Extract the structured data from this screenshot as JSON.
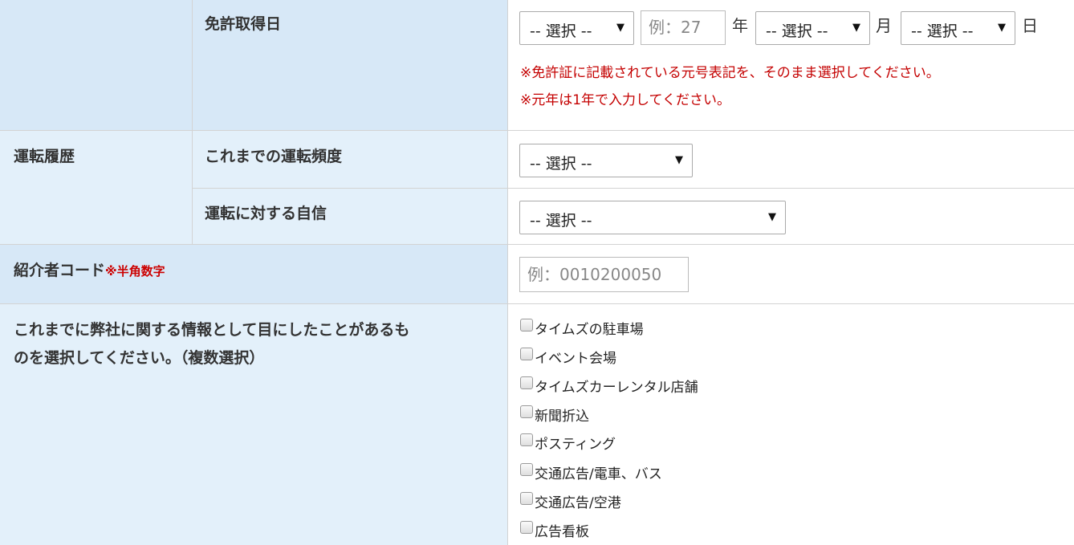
{
  "license_date": {
    "label": "免許取得日",
    "era_select": "-- 選択 --",
    "year_placeholder": "例：27",
    "year_unit": "年",
    "month_select": "-- 選択 --",
    "month_unit": "月",
    "day_select": "-- 選択 --",
    "day_unit": "日",
    "note1": "※免許証に記載されている元号表記を、そのまま選択してください。",
    "note2": "※元年は1年で入力してください。"
  },
  "driving_history": {
    "label": "運転履歴",
    "frequency_label": "これまでの運転頻度",
    "frequency_select": "-- 選択 --",
    "confidence_label": "運転に対する自信",
    "confidence_select": "-- 選択 --"
  },
  "referral": {
    "label": "紹介者コード",
    "note": "※半角数字",
    "placeholder": "例：0010200050"
  },
  "info_sources": {
    "label_line1": "これまでに弊社に関する情報として目にしたことがあるも",
    "label_line2": "のを選択してください。（複数選択）",
    "options": [
      "タイムズの駐車場",
      "イベント会場",
      "タイムズカーレンタル店舗",
      "新聞折込",
      "ポスティング",
      "交通広告/電車、バス",
      "交通広告/空港",
      "広告看板"
    ]
  },
  "icons": {
    "dropdown_arrow": "▼"
  },
  "colors": {
    "label_bg": "#e3f0fa",
    "label_bg_dark": "#d7e8f7",
    "note_red": "#c40000"
  }
}
